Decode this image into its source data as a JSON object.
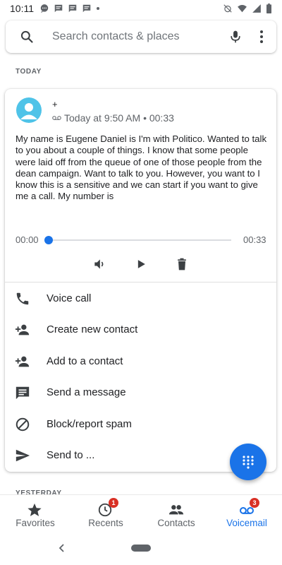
{
  "status_bar": {
    "time": "10:11"
  },
  "search": {
    "placeholder": "Search contacts & places"
  },
  "sections": {
    "today": "TODAY",
    "yesterday": "YESTERDAY"
  },
  "voicemail": {
    "caller": "+",
    "meta": "Today at 9:50 AM • 00:33",
    "transcript": "My name is Eugene Daniel is I'm with Politico. Wanted to talk to you about a couple of things. I know that some people were laid off from the queue of one of those people from the dean campaign. Want to talk to you. However, you want to I know this is a sensitive and we can start if you want to give me a call. My number is",
    "player": {
      "current": "00:00",
      "duration": "00:33",
      "progress": 0
    }
  },
  "actions": [
    {
      "label": "Voice call",
      "icon": "phone-icon"
    },
    {
      "label": "Create new contact",
      "icon": "person-add-icon"
    },
    {
      "label": "Add to a contact",
      "icon": "person-add-icon"
    },
    {
      "label": "Send a message",
      "icon": "message-icon"
    },
    {
      "label": "Block/report spam",
      "icon": "block-icon"
    },
    {
      "label": "Send to ...",
      "icon": "send-icon"
    }
  ],
  "bottom_nav": [
    {
      "label": "Favorites",
      "icon": "star-icon",
      "badge": ""
    },
    {
      "label": "Recents",
      "icon": "clock-icon",
      "badge": "1"
    },
    {
      "label": "Contacts",
      "icon": "people-icon",
      "badge": ""
    },
    {
      "label": "Voicemail",
      "icon": "voicemail-icon",
      "badge": "3",
      "active": true
    }
  ],
  "colors": {
    "accent": "#1a73e8",
    "avatar": "#4fc3e8",
    "badge": "#d93025"
  }
}
